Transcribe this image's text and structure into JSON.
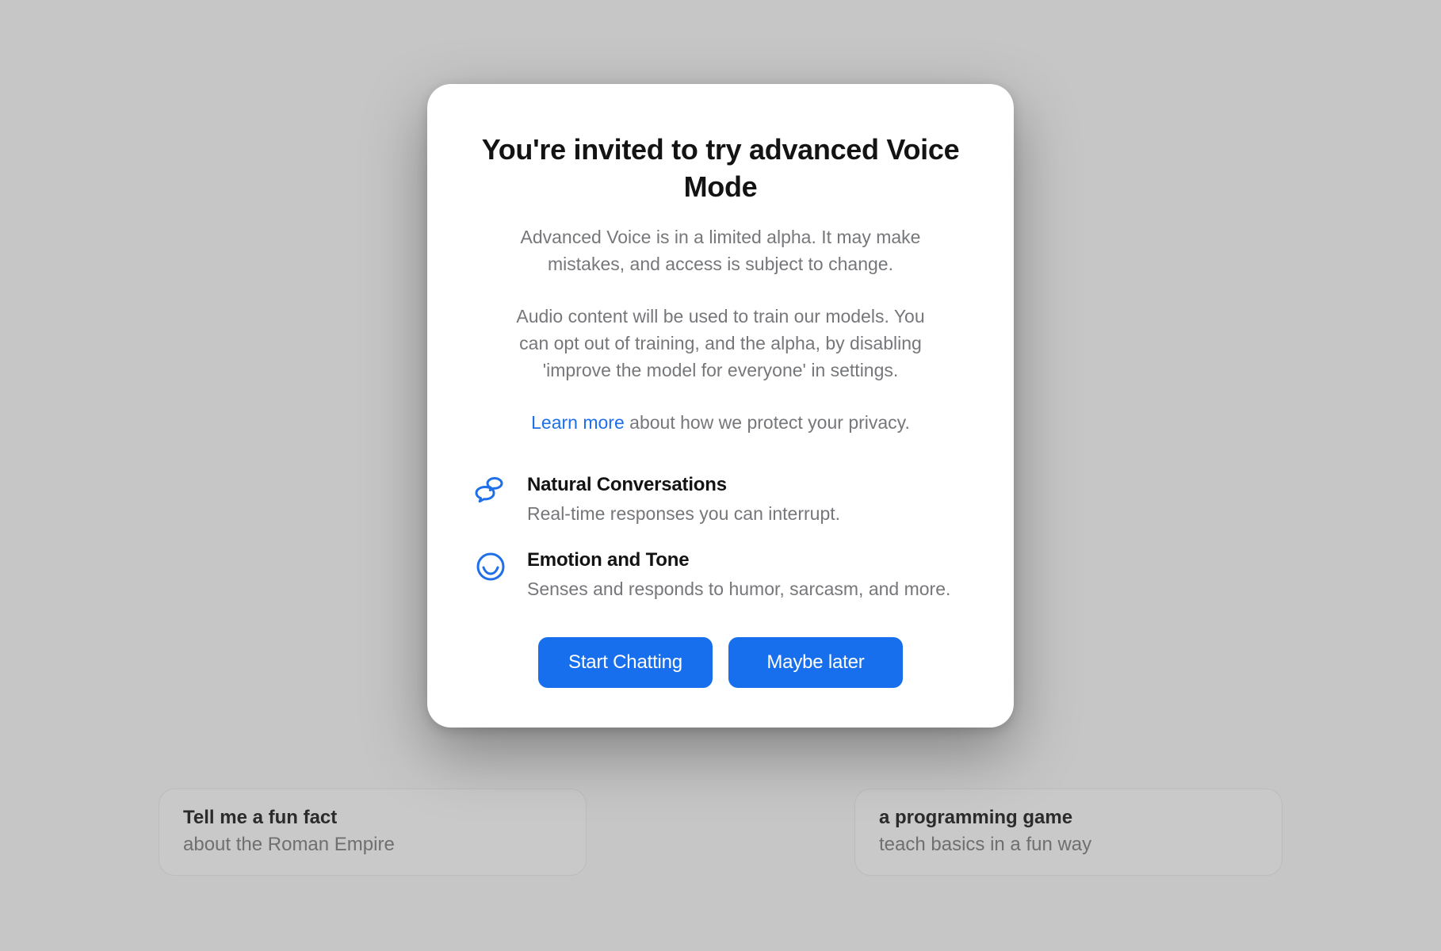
{
  "modal": {
    "title": "You're invited to try advanced Voice Mode",
    "paragraph1": "Advanced Voice is in a limited alpha. It may make mistakes, and access is subject to change.",
    "paragraph2": "Audio content will be used to train our models. You can opt out of training, and the alpha, by disabling 'improve the model for everyone' in settings.",
    "learn_more_link": "Learn more",
    "learn_more_rest": " about how we protect your privacy.",
    "features": [
      {
        "title": "Natural Conversations",
        "desc": "Real-time responses you can interrupt."
      },
      {
        "title": "Emotion and Tone",
        "desc": "Senses and responds to humor, sarcasm, and more."
      }
    ],
    "primary_button": "Start Chatting",
    "secondary_button": "Maybe later"
  },
  "background_suggestions": [
    {
      "title": "Tell me a fun fact",
      "sub": "about the Roman Empire"
    },
    {
      "title": "a programming game",
      "sub": "teach basics in a fun way"
    }
  ],
  "colors": {
    "accent": "#176fed",
    "modal_bg": "#ffffff",
    "page_bg": "#c6c6c6",
    "text_primary": "#131313",
    "text_secondary": "#76777a"
  }
}
